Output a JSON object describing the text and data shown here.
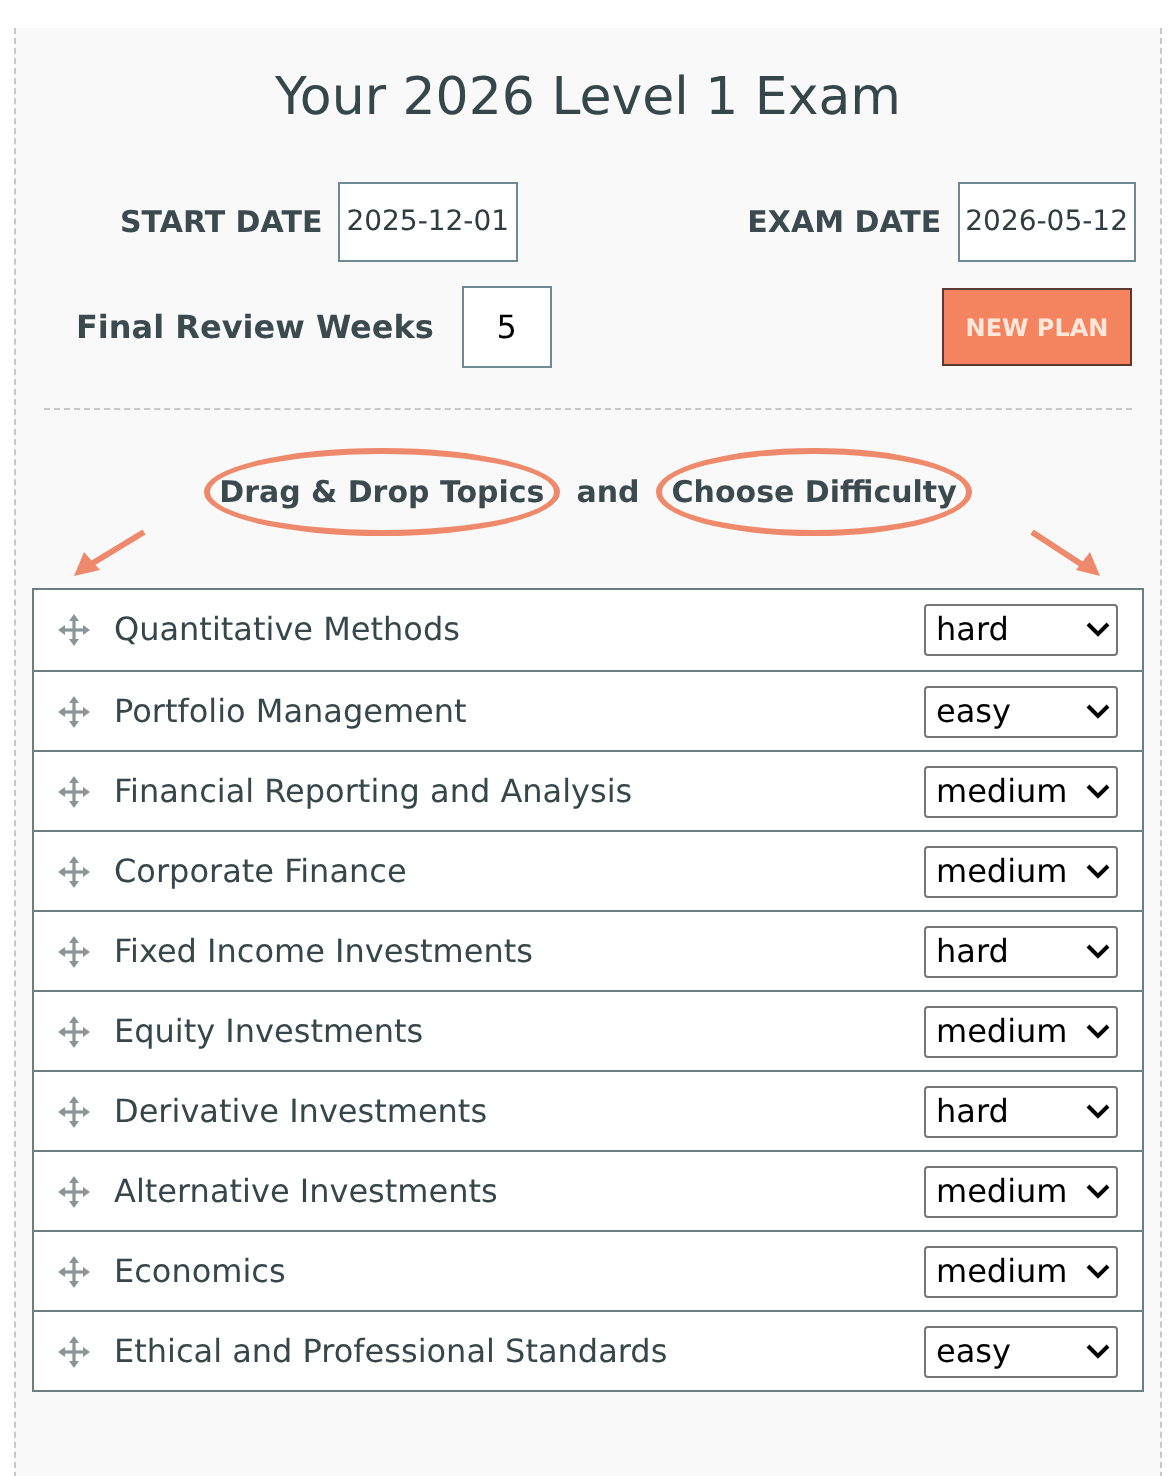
{
  "title": "Your 2026 Level 1 Exam",
  "start_date": {
    "label": "START DATE",
    "value": "2025-12-01"
  },
  "exam_date": {
    "label": "EXAM DATE",
    "value": "2026-05-12"
  },
  "review_weeks": {
    "label": "Final Review Weeks",
    "value": "5"
  },
  "new_plan_button": "NEW PLAN",
  "instruction": [
    {
      "text": "Drag & Drop Topics",
      "circled": true
    },
    {
      "text": "and",
      "circled": false
    },
    {
      "text": "Choose Difficulty",
      "circled": true
    }
  ],
  "topics": [
    {
      "name": "Quantitative Methods",
      "difficulty": "hard"
    },
    {
      "name": "Portfolio Management",
      "difficulty": "easy"
    },
    {
      "name": "Financial Reporting and Analysis",
      "difficulty": "medium"
    },
    {
      "name": "Corporate Finance",
      "difficulty": "medium"
    },
    {
      "name": "Fixed Income Investments",
      "difficulty": "hard"
    },
    {
      "name": "Equity Investments",
      "difficulty": "medium"
    },
    {
      "name": "Derivative Investments",
      "difficulty": "hard"
    },
    {
      "name": "Alternative Investments",
      "difficulty": "medium"
    },
    {
      "name": "Economics",
      "difficulty": "medium"
    },
    {
      "name": "Ethical and Professional Standards",
      "difficulty": "easy"
    }
  ]
}
